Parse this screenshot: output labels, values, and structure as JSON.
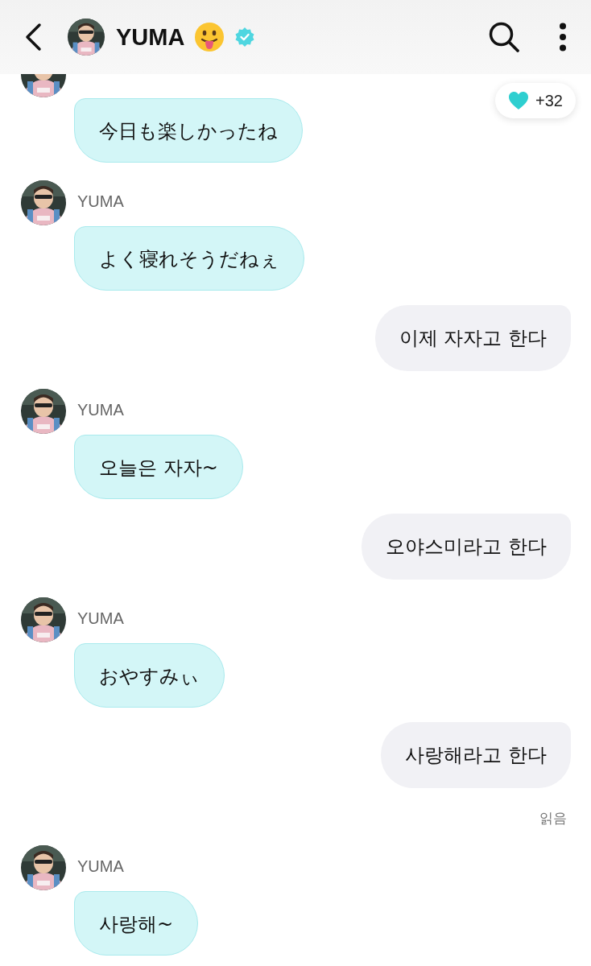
{
  "header": {
    "title": "YUMA",
    "verified": true
  },
  "reaction_badge": {
    "count": "+32"
  },
  "messages": [
    {
      "kind": "received",
      "text": "今日も楽しかったね"
    },
    {
      "kind": "received",
      "sender": "YUMA",
      "text": "よく寝れそうだねぇ"
    },
    {
      "kind": "sent",
      "text": "이제 자자고 한다"
    },
    {
      "kind": "received",
      "sender": "YUMA",
      "text": "오늘은 자자~"
    },
    {
      "kind": "sent",
      "text": "오야스미라고 한다"
    },
    {
      "kind": "received",
      "sender": "YUMA",
      "text": "おやすみぃ"
    },
    {
      "kind": "sent",
      "text": "사랑해라고 한다"
    },
    {
      "kind": "read_receipt",
      "text": "읽음"
    },
    {
      "kind": "received",
      "sender": "YUMA",
      "text": "사랑해~"
    }
  ]
}
